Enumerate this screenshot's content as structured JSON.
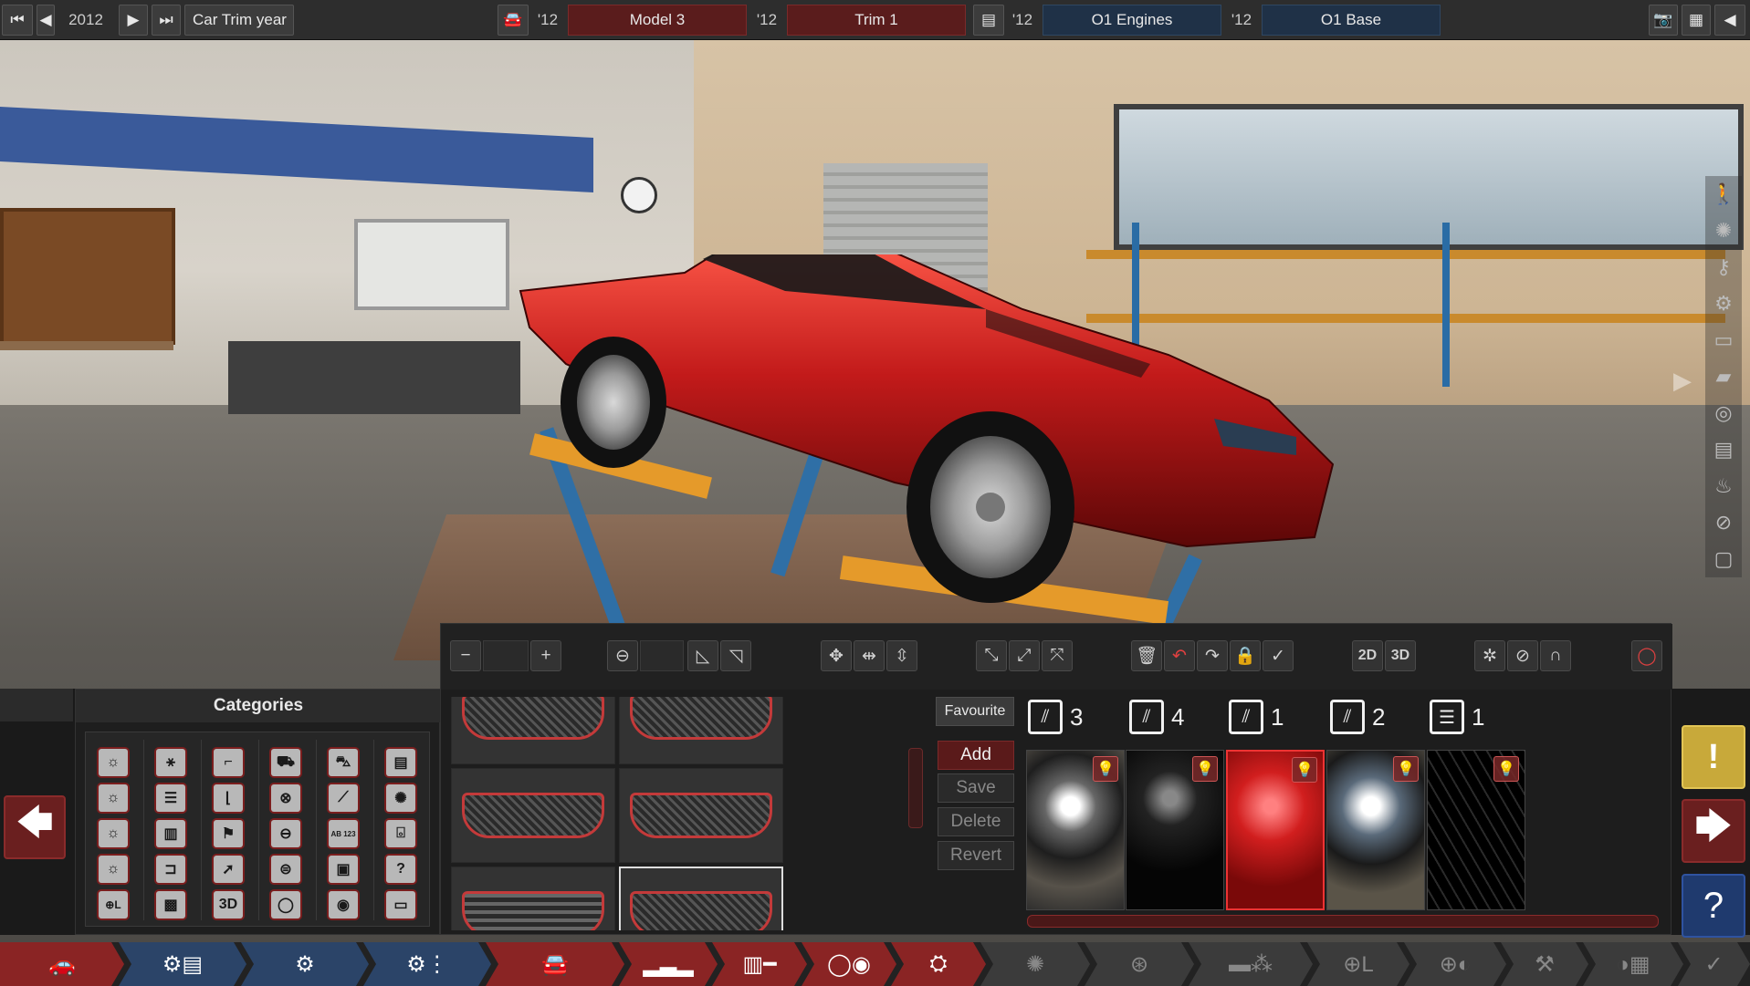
{
  "topbar": {
    "year": "2012",
    "year_label": "Car Trim year",
    "model_year": "'12",
    "model": "Model 3",
    "trim_year": "'12",
    "trim": "Trim 1",
    "engine_year": "'12",
    "engine": "O1 Engines",
    "variant_year": "'12",
    "variant": "O1 Base"
  },
  "categories": {
    "title": "Categories",
    "threed_label": "3D",
    "badge_label": "AB 123"
  },
  "editor": {
    "mode_2d": "2D",
    "mode_3d": "3D"
  },
  "actions": {
    "favourite": "Favourite",
    "add": "Add",
    "save": "Save",
    "delete": "Delete",
    "revert": "Revert"
  },
  "materials": {
    "headers": [
      {
        "icon": "material-glass-icon",
        "count": "3"
      },
      {
        "icon": "material-glass-icon",
        "count": "4"
      },
      {
        "icon": "material-glass-icon",
        "count": "1"
      },
      {
        "icon": "material-glass-icon",
        "count": "2"
      },
      {
        "icon": "grille-pattern-icon",
        "count": "1"
      }
    ],
    "swatches": [
      {
        "name": "chrome",
        "color": "#2a2a2a"
      },
      {
        "name": "black-gloss",
        "color": "#0d0d0d"
      },
      {
        "name": "red-metallic",
        "color": "#b81919"
      },
      {
        "name": "chrome-2",
        "color": "#3a3a3a"
      },
      {
        "name": "hex-pattern",
        "color": "#111111"
      }
    ]
  },
  "colors": {
    "accent_red": "#8a2424",
    "accent_blue": "#2b4468",
    "car_red": "#c21a1a",
    "warning_yellow": "#c8a93a"
  }
}
